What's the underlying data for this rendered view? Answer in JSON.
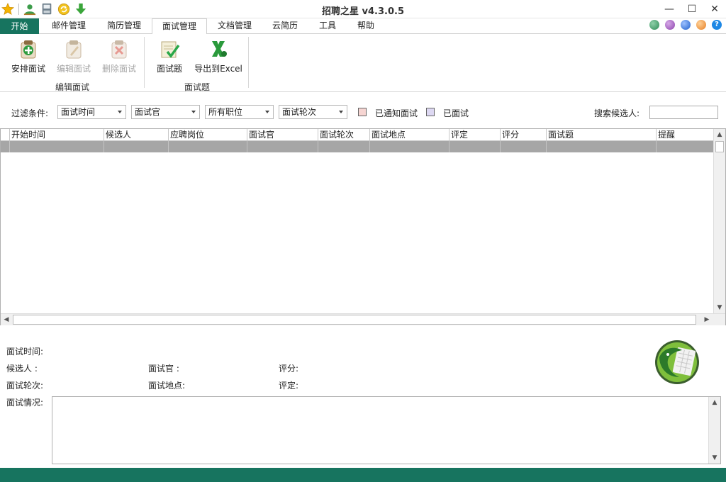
{
  "window": {
    "title": "招聘之星 v4.3.0.5",
    "minimize": "—",
    "maximize": "☐",
    "close": "✕"
  },
  "quick_access": [
    "star-icon",
    "user-icon",
    "save-icon",
    "refresh-icon",
    "download-icon"
  ],
  "menu": {
    "start": "开始",
    "tabs": [
      "邮件管理",
      "简历管理",
      "面试管理",
      "文档管理",
      "云简历",
      "工具",
      "帮助"
    ],
    "active": "面试管理",
    "orb_colors": [
      "#2e8b57",
      "#8e44ad",
      "#1f5fcc",
      "#e67e22",
      "#1e88e5"
    ],
    "help": "?"
  },
  "ribbon": {
    "groups": [
      {
        "label": "编辑面试",
        "buttons": [
          "安排面试",
          "编辑面试",
          "删除面试"
        ]
      },
      {
        "label": "面试题",
        "buttons": [
          "面试题",
          "导出到Excel"
        ]
      }
    ]
  },
  "filter": {
    "label": "过滤条件:",
    "combos": [
      "面试时间",
      "面试官",
      "所有职位",
      "面试轮次"
    ],
    "legend_notified": "已通知面试",
    "legend_interviewed": "已面试",
    "legend_notified_color": "#f6d5d2",
    "legend_interviewed_color": "#ddd8f2",
    "search_label": "搜索候选人:",
    "search_value": ""
  },
  "grid": {
    "columns": [
      "开始时间",
      "候选人",
      "应聘岗位",
      "面试官",
      "面试轮次",
      "面试地点",
      "评定",
      "评分",
      "面试题",
      "提醒"
    ],
    "rows": [
      [
        "",
        "",
        "",
        "",
        "",
        "",
        "",
        "",
        "",
        ""
      ]
    ]
  },
  "details": {
    "time_label": "面试时间:",
    "candidate_label": "候选人  :",
    "interviewer_label": "面试官  :",
    "score_label": "评分:",
    "round_label": "面试轮次:",
    "location_label": "面试地点:",
    "rating_label": "评定:",
    "notes_label": "面试情况:",
    "notes_value": ""
  },
  "colors": {
    "brand": "#17745f"
  }
}
